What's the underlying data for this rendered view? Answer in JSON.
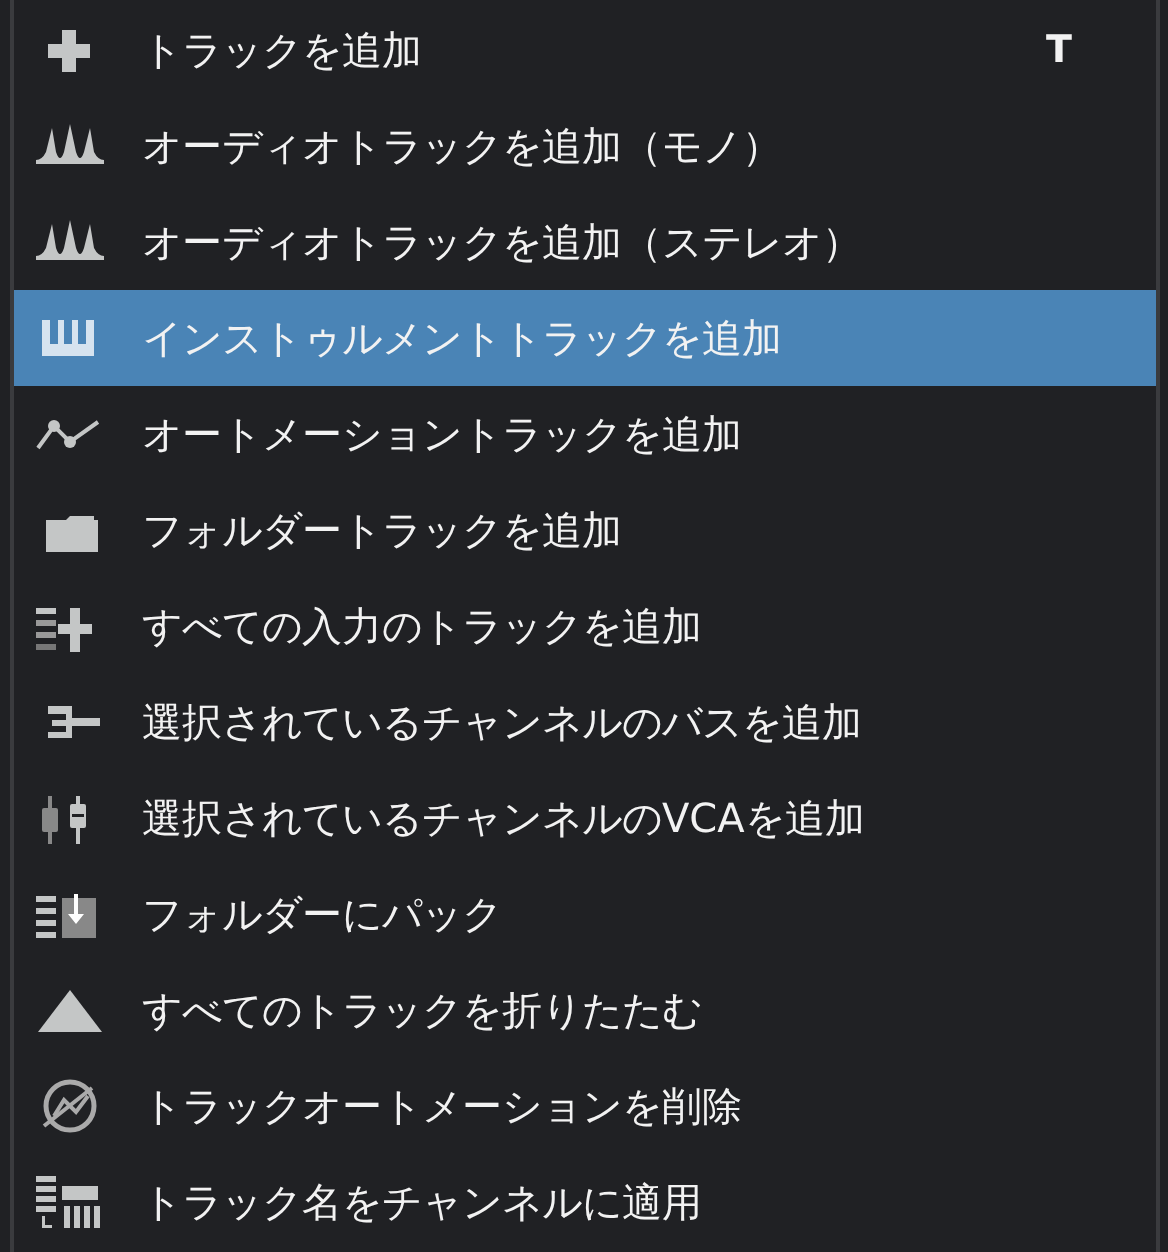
{
  "menu": {
    "items": [
      {
        "label": "トラックを追加",
        "shortcut": "T",
        "selected": false
      },
      {
        "label": "オーディオトラックを追加（モノ）",
        "selected": false
      },
      {
        "label": "オーディオトラックを追加（ステレオ）",
        "selected": false
      },
      {
        "label": "インストゥルメントトラックを追加",
        "selected": true
      },
      {
        "label": "オートメーショントラックを追加",
        "selected": false
      },
      {
        "label": "フォルダートラックを追加",
        "selected": false
      },
      {
        "label": "すべての入力のトラックを追加",
        "selected": false
      },
      {
        "label": "選択されているチャンネルのバスを追加",
        "selected": false
      },
      {
        "label": "選択されているチャンネルのVCAを追加",
        "selected": false
      },
      {
        "label": "フォルダーにパック",
        "selected": false
      },
      {
        "label": "すべてのトラックを折りたたむ",
        "selected": false
      },
      {
        "label": "トラックオートメーションを削除",
        "selected": false
      },
      {
        "label": "トラック名をチャンネルに適用",
        "selected": false
      }
    ]
  }
}
